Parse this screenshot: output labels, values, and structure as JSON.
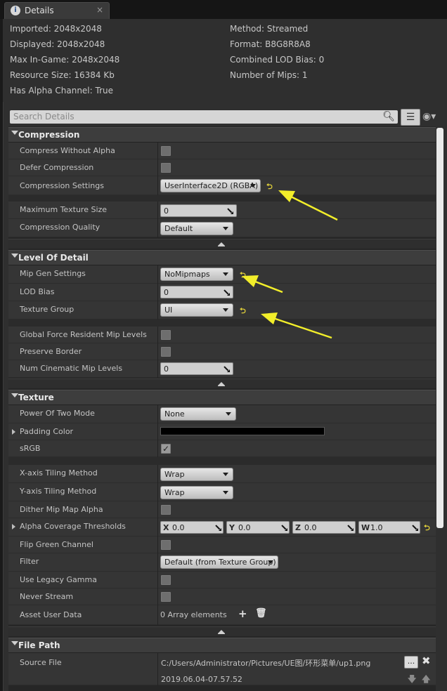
{
  "tab": {
    "title": "Details",
    "icon": "info-icon",
    "close": "×"
  },
  "info": {
    "imported": "Imported: 2048x2048",
    "displayed": "Displayed: 2048x2048",
    "max_in_game": "Max In-Game: 2048x2048",
    "resource_size": "Resource Size: 16384 Kb",
    "has_alpha": "Has Alpha Channel: True",
    "method": "Method: Streamed",
    "format": "Format: B8G8R8A8",
    "combined_lod_bias": "Combined LOD Bias: 0",
    "num_mips": "Number of Mips: 1"
  },
  "search": {
    "placeholder": "Search Details"
  },
  "categories": {
    "compression": "Compression",
    "lod": "Level Of Detail",
    "texture": "Texture",
    "file_path": "File Path"
  },
  "compression": {
    "compress_without_alpha": "Compress Without Alpha",
    "defer_compression": "Defer Compression",
    "compression_settings": "Compression Settings",
    "compression_settings_value": "UserInterface2D (RGBA)",
    "max_texture_size": "Maximum Texture Size",
    "max_texture_size_value": "0",
    "compression_quality": "Compression Quality",
    "compression_quality_value": "Default"
  },
  "lod": {
    "mip_gen_settings": "Mip Gen Settings",
    "mip_gen_settings_value": "NoMipmaps",
    "lod_bias": "LOD Bias",
    "lod_bias_value": "0",
    "texture_group": "Texture Group",
    "texture_group_value": "UI",
    "global_force_resident": "Global Force Resident Mip Levels",
    "preserve_border": "Preserve Border",
    "num_cinematic_mip_levels": "Num Cinematic Mip Levels",
    "num_cinematic_mip_levels_value": "0"
  },
  "texture": {
    "power_of_two_mode": "Power Of Two Mode",
    "power_of_two_mode_value": "None",
    "padding_color": "Padding Color",
    "padding_color_hex": "#000000",
    "srgb": "sRGB",
    "x_axis_tiling": "X-axis Tiling Method",
    "x_axis_tiling_value": "Wrap",
    "y_axis_tiling": "Y-axis Tiling Method",
    "y_axis_tiling_value": "Wrap",
    "dither_mip_map_alpha": "Dither Mip Map Alpha",
    "alpha_coverage_thresholds": "Alpha Coverage Thresholds",
    "alpha_x_label": "X",
    "alpha_x_value": "0.0",
    "alpha_y_label": "Y",
    "alpha_y_value": "0.0",
    "alpha_z_label": "Z",
    "alpha_z_value": "0.0",
    "alpha_w_label": "W",
    "alpha_w_value": "1.0",
    "flip_green_channel": "Flip Green Channel",
    "filter": "Filter",
    "filter_value": "Default (from Texture Group)",
    "use_legacy_gamma": "Use Legacy Gamma",
    "never_stream": "Never Stream",
    "asset_user_data": "Asset User Data",
    "asset_user_data_value": "0 Array elements"
  },
  "file_path": {
    "source_file": "Source File",
    "source_file_value": "C:/Users/Administrator/Pictures/UE图/环形菜单/up1.png",
    "timestamp": "2019.06.04-07.57.52",
    "browse_button": "..."
  },
  "colors": {
    "annotation_arrow": "#f2ee2a",
    "reset_arrow": "#e3d23a",
    "panel_bg": "#2f2f2f",
    "row_bg": "#353535",
    "category_bg": "#3d3d3d"
  }
}
